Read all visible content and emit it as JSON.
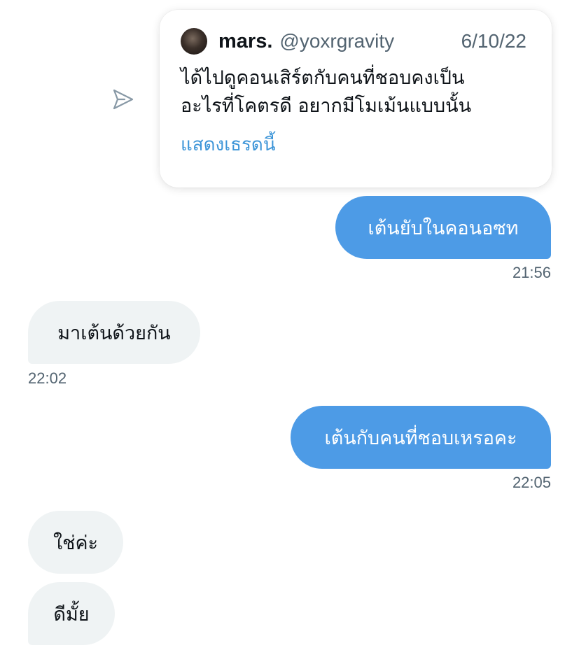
{
  "shared_tweet": {
    "display_name": "mars.",
    "handle": "@yoxrgravity",
    "date": "6/10/22",
    "text_lines": [
      "ได้ไปดูคอนเสิร์ตกับคนที่ชอบคงเป็น",
      "อะไรที่โคตรดี อยากมีโมเม้นแบบนั้น"
    ],
    "show_thread_label": "แสดงเธรดนี้"
  },
  "messages": [
    {
      "direction": "outgoing",
      "text": "เต้นยับในคอนอซท",
      "time": "21:56"
    },
    {
      "direction": "incoming",
      "text": "มาเต้นด้วยกัน",
      "time": "22:02"
    },
    {
      "direction": "outgoing",
      "text": "เต้นกับคนที่ชอบเหรอคะ",
      "time": "22:05"
    },
    {
      "direction": "incoming",
      "text": "ใช่ค่ะ",
      "time": ""
    },
    {
      "direction": "incoming",
      "text": "ดีมั้ย",
      "time": ""
    }
  ],
  "colors": {
    "outgoing_bubble": "#4d9be6",
    "incoming_bubble": "#eff3f4",
    "link": "#3d95d8",
    "muted_text": "#536471"
  }
}
